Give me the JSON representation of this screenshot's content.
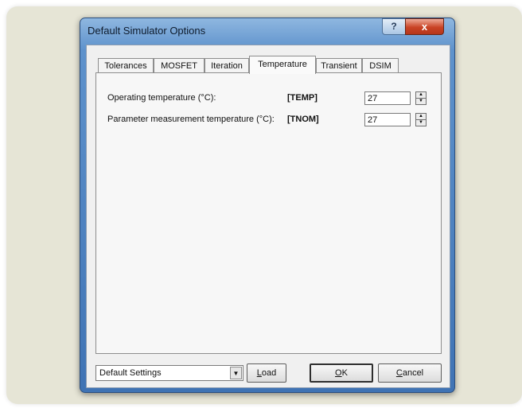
{
  "window": {
    "title": "Default Simulator Options",
    "help_label": "?",
    "close_label": "x"
  },
  "tabs": [
    {
      "label": "Tolerances"
    },
    {
      "label": "MOSFET"
    },
    {
      "label": "Iteration"
    },
    {
      "label": "Temperature",
      "active": true
    },
    {
      "label": "Transient"
    },
    {
      "label": "DSIM"
    }
  ],
  "fields": [
    {
      "label": "Operating temperature (°C):",
      "param": "[TEMP]",
      "value": "27"
    },
    {
      "label": "Parameter measurement temperature (°C):",
      "param": "[TNOM]",
      "value": "27"
    }
  ],
  "footer": {
    "settings_value": "Default Settings",
    "load_label_u": "L",
    "load_label_rest": "oad",
    "ok_label_u": "O",
    "ok_label_rest": "K",
    "cancel_label_u": "C",
    "cancel_label_rest": "ancel"
  }
}
